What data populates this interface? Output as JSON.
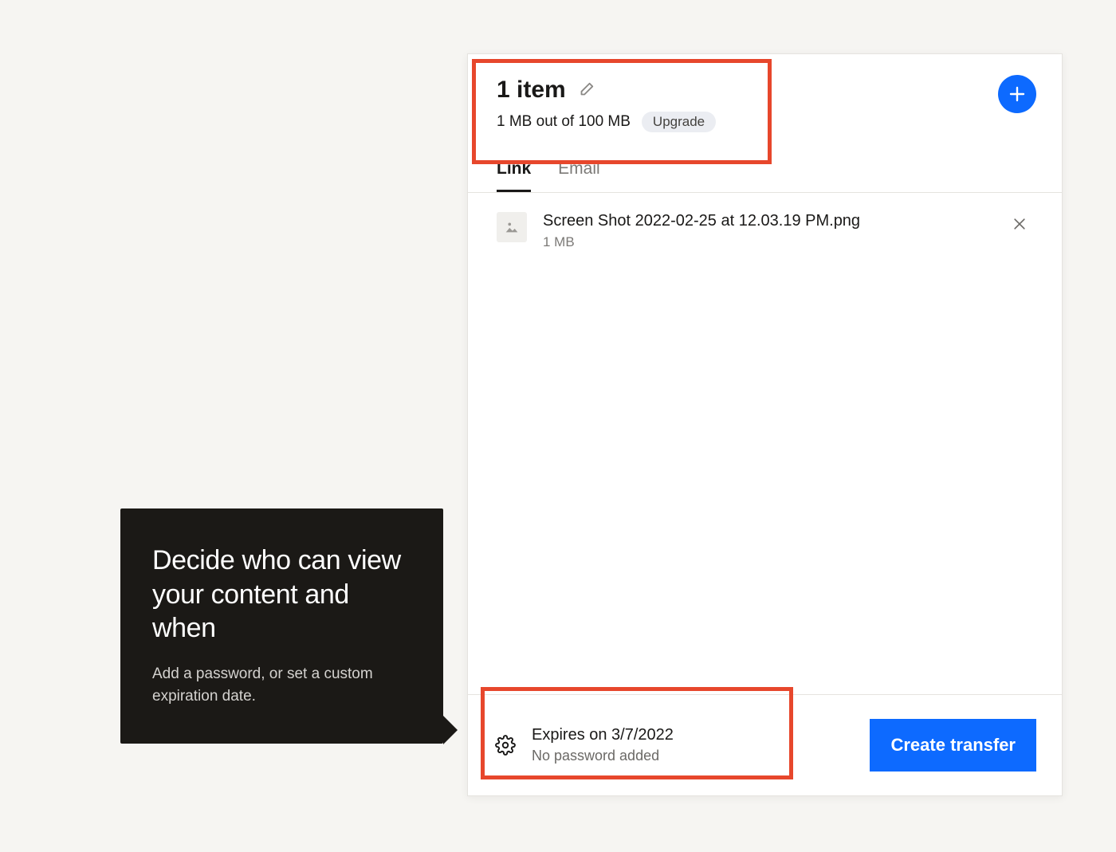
{
  "tooltip": {
    "heading": "Decide who can view your content and when",
    "body": "Add a password, or set a custom expiration date."
  },
  "modal": {
    "title": "1 item",
    "size_line": "1 MB out of 100 MB",
    "upgrade_label": "Upgrade",
    "tabs": [
      {
        "label": "Link",
        "active": true
      },
      {
        "label": "Email",
        "active": false
      }
    ],
    "files": [
      {
        "name": "Screen Shot 2022-02-25 at 12.03.19 PM.png",
        "size": "1 MB"
      }
    ],
    "footer": {
      "expires_line": "Expires on 3/7/2022",
      "password_line": "No password added",
      "create_label": "Create transfer"
    }
  }
}
